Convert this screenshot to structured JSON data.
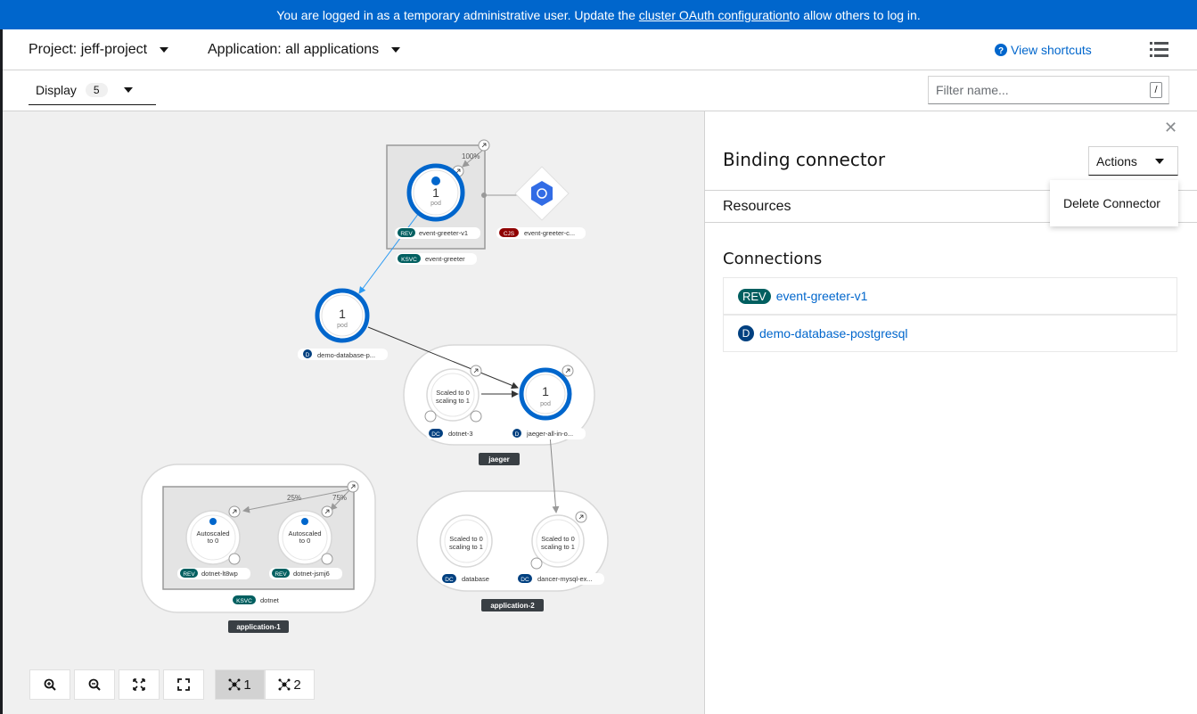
{
  "banner": {
    "text_before": "You are logged in as a temporary administrative user. Update the ",
    "link": "cluster OAuth configuration",
    "text_after": " to allow others to log in."
  },
  "context": {
    "project": "Project: jeff-project",
    "application": "Application: all applications",
    "shortcuts": "View shortcuts"
  },
  "toolbar": {
    "display_label": "Display",
    "display_count": "5",
    "filter_placeholder": "Filter name...",
    "filter_shortcut": "/"
  },
  "topology": {
    "groups": {
      "jaeger": "jaeger",
      "app1": "application-1",
      "app2": "application-2"
    },
    "nodes": {
      "greeter_pod_count": "1",
      "greeter_pod_unit": "pod",
      "greeter_traffic": "100%",
      "greeter_rev_badge": "REV",
      "greeter_rev_name": "event-greeter-v1",
      "greeter_ksvc_badge": "KSVC",
      "greeter_ksvc_name": "event-greeter",
      "cron_badge": "CJS",
      "cron_name": "event-greeter-c...",
      "db_pod_count": "1",
      "db_pod_unit": "pod",
      "db_badge": "D",
      "db_name": "demo-database-p...",
      "dotnet3_line1": "Scaled to 0",
      "dotnet3_line2": "scaling to 1",
      "dotnet3_badge": "DC",
      "dotnet3_name": "dotnet-3",
      "jaeger_pod_count": "1",
      "jaeger_pod_unit": "pod",
      "jaeger_badge": "D",
      "jaeger_name": "jaeger-all-in-o...",
      "rev1_traffic": "25%",
      "rev2_traffic": "75%",
      "rev1_line1": "Autoscaled",
      "rev1_line2": "to 0",
      "rev1_badge": "REV",
      "rev1_name": "dotnet-lt8wp",
      "rev2_line1": "Autoscaled",
      "rev2_line2": "to 0",
      "rev2_badge": "REV",
      "rev2_name": "dotnet-jsmj6",
      "dotnet_ksvc_badge": "KSVC",
      "dotnet_ksvc_name": "dotnet",
      "database_line1": "Scaled to 0",
      "database_line2": "scaling to 1",
      "database_badge": "DC",
      "database_name": "database",
      "dancer_line1": "Scaled to 0",
      "dancer_line2": "scaling to 1",
      "dancer_badge": "DC",
      "dancer_name": "dancer-mysql-ex..."
    },
    "controls": {
      "layout1": "1",
      "layout2": "2"
    }
  },
  "sidepanel": {
    "title": "Binding connector",
    "actions_label": "Actions",
    "menu_item": "Delete Connector",
    "tab_resources": "Resources",
    "connections_heading": "Connections",
    "connections": [
      {
        "badge": "REV",
        "name": "event-greeter-v1"
      },
      {
        "badge": "D",
        "name": "demo-database-postgresql"
      }
    ]
  },
  "colors": {
    "brand_blue": "#0066cc",
    "rev_badge": "#005f60",
    "ksvc_badge": "#005f60",
    "cjs_badge": "#8f0000",
    "d_badge": "#004080",
    "dc_badge": "#004080"
  }
}
